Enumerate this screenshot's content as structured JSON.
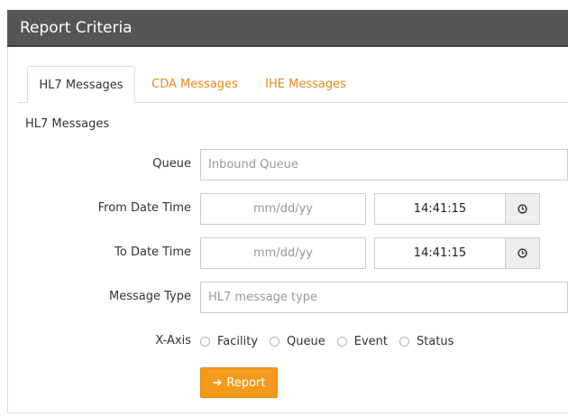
{
  "panel": {
    "title": "Report Criteria"
  },
  "tabs": [
    {
      "label": "HL7 Messages",
      "active": true
    },
    {
      "label": "CDA Messages",
      "active": false
    },
    {
      "label": "IHE Messages",
      "active": false
    }
  ],
  "section_title": "HL7 Messages",
  "form": {
    "queue": {
      "label": "Queue",
      "placeholder": "Inbound Queue"
    },
    "from": {
      "label": "From Date Time",
      "date_placeholder": "mm/dd/yy",
      "time_value": "14:41:15"
    },
    "to": {
      "label": "To Date Time",
      "date_placeholder": "mm/dd/yy",
      "time_value": "14:41:15"
    },
    "message_type": {
      "label": "Message Type",
      "placeholder": "HL7 message type"
    },
    "x_axis": {
      "label": "X-Axis",
      "options": [
        "Facility",
        "Queue",
        "Event",
        "Status"
      ]
    }
  },
  "report_button": {
    "label": "Report",
    "icon": "arrow-right-icon"
  },
  "colors": {
    "header_bg": "#555555",
    "accent": "#e8891d",
    "button_bg": "#f39a1e"
  }
}
